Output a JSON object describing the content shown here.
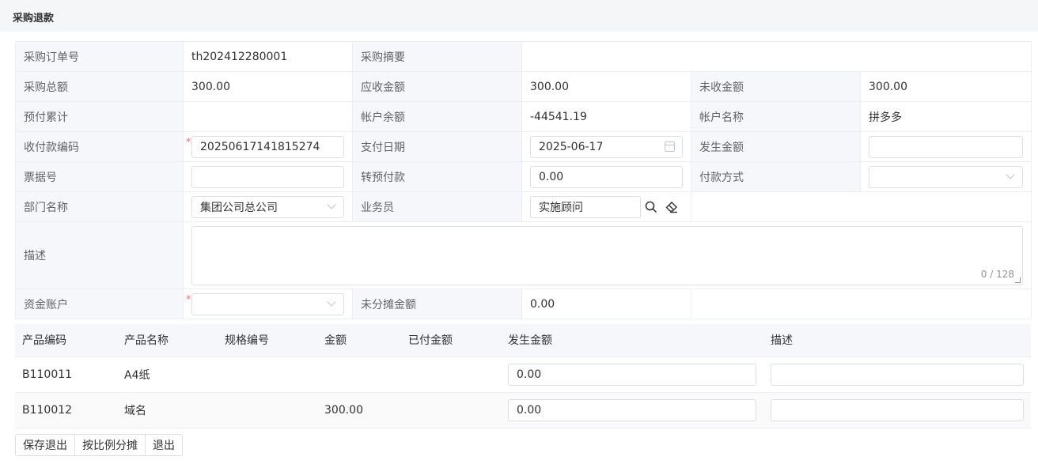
{
  "page": {
    "title": "采购退款"
  },
  "form": {
    "order_no_label": "采购订单号",
    "order_no": "th202412280001",
    "summary_label": "采购摘要",
    "summary": "",
    "total_label": "采购总额",
    "total": "300.00",
    "receivable_label": "应收金额",
    "receivable": "300.00",
    "unreceived_label": "未收金额",
    "unreceived": "300.00",
    "prepaid_label": "预付累计",
    "prepaid": "",
    "balance_label": "帐户余额",
    "balance": "-44541.19",
    "account_name_label": "帐户名称",
    "account_name": "拼多多",
    "payment_code_label": "收付款编码",
    "payment_code": "20250617141815274",
    "pay_date_label": "支付日期",
    "pay_date": "2025-06-17",
    "amount_label": "发生金额",
    "amount": "",
    "bill_no_label": "票据号",
    "bill_no": "",
    "to_prepay_label": "转预付款",
    "to_prepay": "0.00",
    "pay_method_label": "付款方式",
    "pay_method": "",
    "dept_label": "部门名称",
    "dept": "集团公司总公司",
    "salesman_label": "业务员",
    "salesman": "实施顾问",
    "desc_label": "描述",
    "desc_count": "0 / 128",
    "fund_account_label": "资金账户",
    "fund_account": "",
    "unallocated_label": "未分摊金额",
    "unallocated": "0.00",
    "required_mark": "*"
  },
  "detail": {
    "headers": [
      "产品编码",
      "产品名称",
      "规格编号",
      "金额",
      "已付金额",
      "发生金额",
      "描述"
    ],
    "rows": [
      {
        "code": "B110011",
        "name": "A4纸",
        "spec": "",
        "amount": "",
        "paid": "",
        "occur": "0.00",
        "desc": ""
      },
      {
        "code": "B110012",
        "name": "域名",
        "spec": "",
        "amount": "300.00",
        "paid": "",
        "occur": "0.00",
        "desc": ""
      }
    ]
  },
  "buttons": {
    "save_exit": "保存退出",
    "allocate": "按比例分摊",
    "exit": "退出"
  },
  "icons": {
    "search": "search-icon",
    "clear": "eraser-icon",
    "calendar": "calendar-icon",
    "dropdown": "chevron-down-icon"
  }
}
